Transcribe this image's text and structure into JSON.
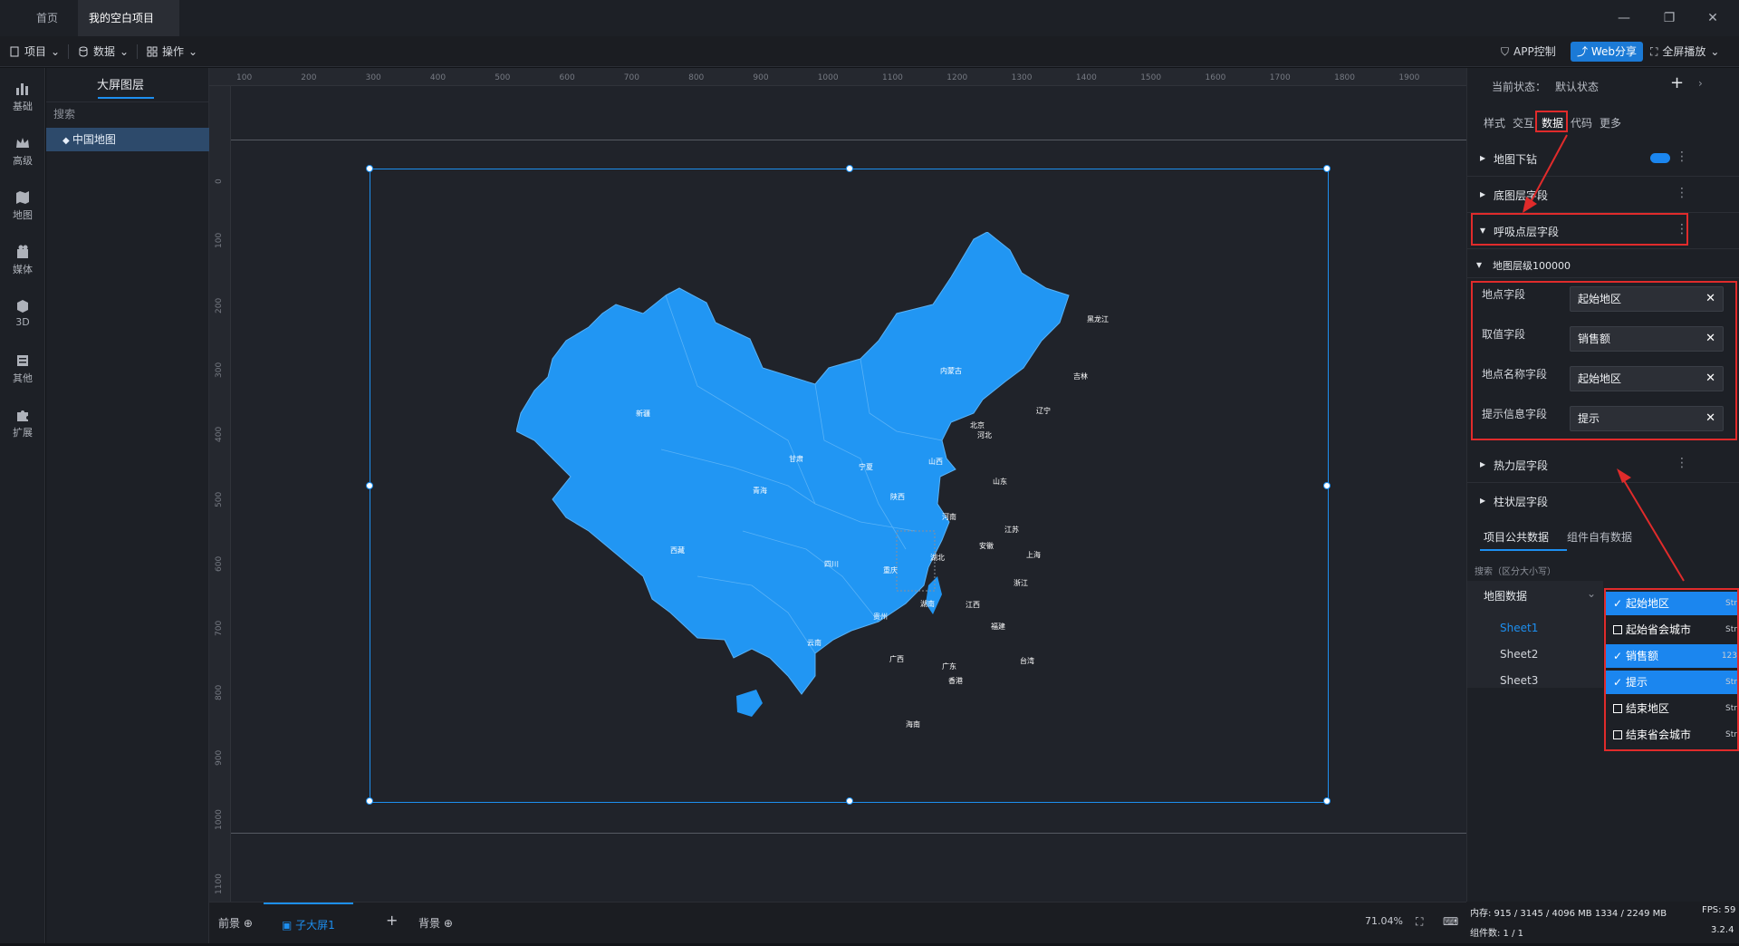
{
  "tabs": [
    "首页",
    "我的空白项目"
  ],
  "toolbar": {
    "menus": [
      "项目",
      "数据",
      "操作"
    ],
    "app_control": "APP控制",
    "web_share": "Web分享",
    "fullscreen": "全屏播放"
  },
  "left_nav": [
    "基础",
    "高级",
    "地图",
    "媒体",
    "3D",
    "其他",
    "扩展"
  ],
  "layer_panel": {
    "title": "大屏图层",
    "search": "搜索",
    "item": "中国地图"
  },
  "ruler": {
    "top": [
      "100",
      "200",
      "300",
      "400",
      "500",
      "600",
      "700",
      "800",
      "900",
      "1000",
      "1100",
      "1200",
      "1300",
      "1400",
      "1500",
      "1600",
      "1700",
      "1800",
      "1900"
    ],
    "left": [
      "0",
      "100",
      "200",
      "300",
      "400",
      "500",
      "600",
      "700",
      "800",
      "900",
      "1000",
      "1100"
    ]
  },
  "map_labels": [
    "黑龙江",
    "吉林",
    "辽宁",
    "内蒙古",
    "北京",
    "河北",
    "新疆",
    "甘肃",
    "宁夏",
    "山西",
    "山东",
    "青海",
    "陕西",
    "河南",
    "江苏",
    "安徽",
    "上海",
    "西藏",
    "四川",
    "湖北",
    "重庆",
    "浙江",
    "湖南",
    "江西",
    "贵州",
    "福建",
    "云南",
    "广西",
    "广东",
    "台湾",
    "香港",
    "海南"
  ],
  "bottom": {
    "front": "前景",
    "child": "子大屏1",
    "background": "背景",
    "zoom": "71.04%"
  },
  "right_panel": {
    "state_label": "当前状态：",
    "state_value": "默认状态",
    "tabs": [
      "样式",
      "交互",
      "数据",
      "代码",
      "更多"
    ],
    "sections": {
      "drill": "地图下钻",
      "base": "底图层字段",
      "breath": "呼吸点层字段",
      "level": "地图层级100000",
      "heat": "热力层字段",
      "flight": "柱状层字段"
    },
    "fields": [
      {
        "label": "地点字段",
        "value": "起始地区"
      },
      {
        "label": "取值字段",
        "value": "销售额"
      },
      {
        "label": "地点名称字段",
        "value": "起始地区"
      },
      {
        "label": "提示信息字段",
        "value": "提示"
      }
    ],
    "data_tabs": [
      "项目公共数据",
      "组件自有数据"
    ],
    "search_placeholder": "搜索（区分大小写）",
    "dataset": "地图数据",
    "sheets": [
      "Sheet1",
      "Sheet2",
      "Sheet3"
    ]
  },
  "dropdown": [
    {
      "label": "起始地区",
      "checked": true,
      "type": "Str"
    },
    {
      "label": "起始省会城市",
      "checked": false,
      "type": "Str"
    },
    {
      "label": "销售额",
      "checked": true,
      "type": "123"
    },
    {
      "label": "提示",
      "checked": true,
      "type": "Str"
    },
    {
      "label": "结束地区",
      "checked": false,
      "type": "Str"
    },
    {
      "label": "结束省会城市",
      "checked": false,
      "type": "Str"
    }
  ],
  "status": {
    "memory": "内存: 915 / 3145 / 4096 MB  1334 / 2249 MB",
    "fps": "FPS: 59",
    "components": "组件数: 1 / 1",
    "version": "3.2.4"
  },
  "colors": {
    "accent": "#1b86ef",
    "map_fill": "#2196f3",
    "highlight": "#e02b2b"
  }
}
